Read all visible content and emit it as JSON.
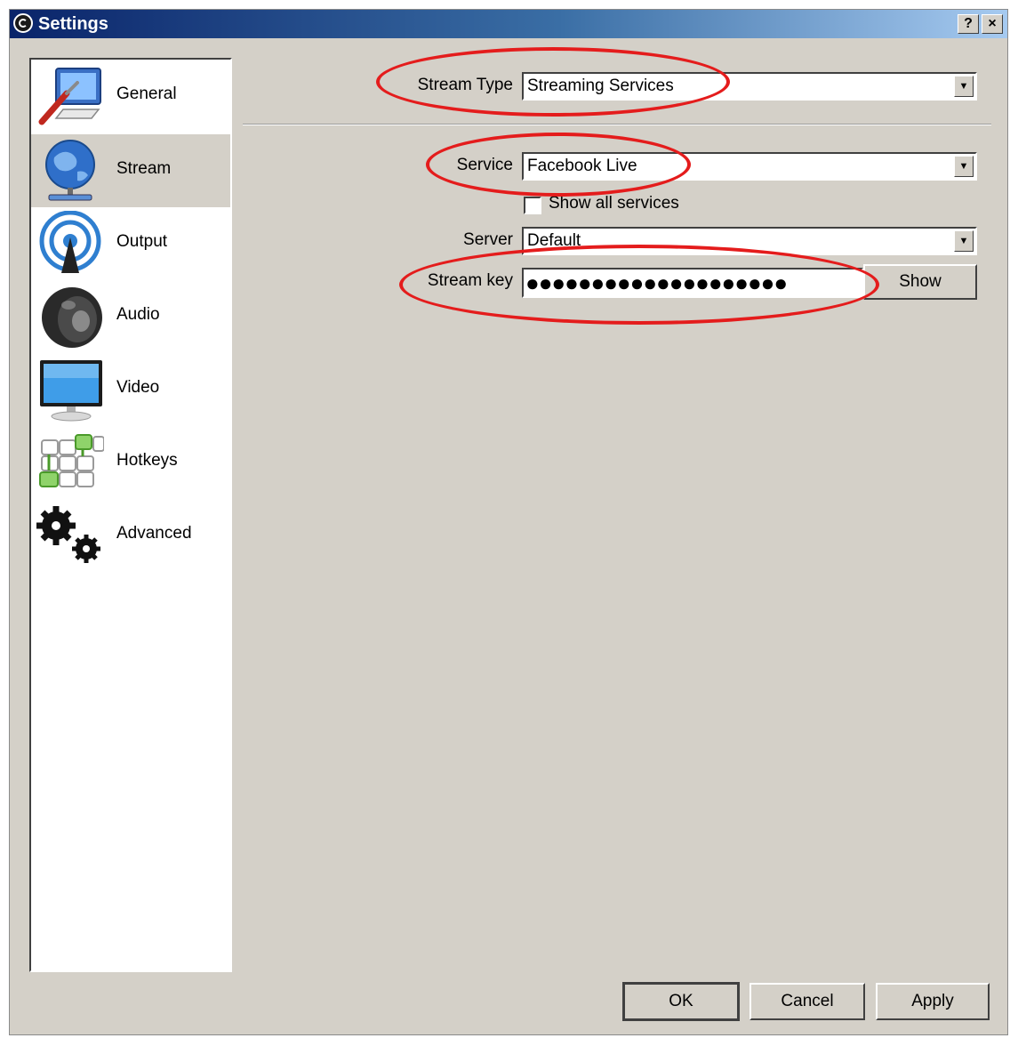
{
  "window": {
    "title": "Settings",
    "help_label": "?",
    "close_label": "×"
  },
  "sidebar": {
    "items": [
      {
        "label": "General",
        "icon": "general-settings-icon"
      },
      {
        "label": "Stream",
        "icon": "globe-network-icon",
        "selected": true
      },
      {
        "label": "Output",
        "icon": "broadcast-antenna-icon"
      },
      {
        "label": "Audio",
        "icon": "speaker-icon"
      },
      {
        "label": "Video",
        "icon": "monitor-icon"
      },
      {
        "label": "Hotkeys",
        "icon": "keyboard-icon"
      },
      {
        "label": "Advanced",
        "icon": "gears-icon"
      }
    ]
  },
  "stream": {
    "stream_type_label": "Stream Type",
    "stream_type_value": "Streaming Services",
    "service_label": "Service",
    "service_value": "Facebook Live",
    "show_all_label": "Show all services",
    "server_label": "Server",
    "server_value": "Default",
    "stream_key_label": "Stream key",
    "stream_key_masked": "●●●●●●●●●●●●●●●●●●●●",
    "show_button": "Show"
  },
  "buttons": {
    "ok": "OK",
    "cancel": "Cancel",
    "apply": "Apply"
  },
  "colors": {
    "annotation": "#e41c1c",
    "dialog_bg": "#d4d0c8",
    "titlebar": "#0a246a"
  }
}
